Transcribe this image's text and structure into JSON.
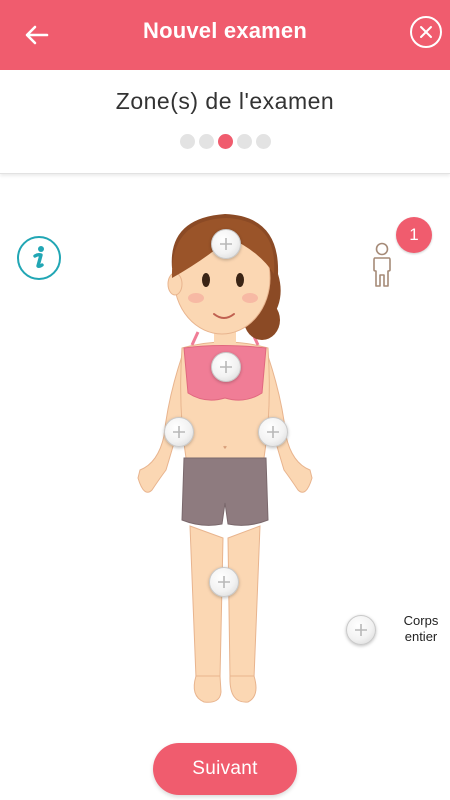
{
  "header": {
    "title": "Nouvel examen",
    "back_icon": "arrow-left-icon",
    "close_icon": "close-icon",
    "background": "#f05c6e"
  },
  "step": {
    "title": "Zone(s) de l'examen",
    "total_steps": 5,
    "current_step": 3,
    "active_color": "#f05c6e",
    "inactive_color": "#e3e3e3"
  },
  "info": {
    "icon": "info-icon",
    "color": "#21a6b4"
  },
  "body_selector": {
    "selected_count": "1",
    "person_icon": "person-outline-icon",
    "zones": [
      {
        "name": "zone-head-button",
        "id": "head"
      },
      {
        "name": "zone-chest-button",
        "id": "chest"
      },
      {
        "name": "zone-right-arm-button",
        "id": "right-arm"
      },
      {
        "name": "zone-left-arm-button",
        "id": "left-arm"
      },
      {
        "name": "zone-legs-button",
        "id": "legs"
      },
      {
        "name": "zone-whole-body-button",
        "id": "whole-body"
      }
    ],
    "whole_body_label": "Corps entier"
  },
  "footer": {
    "next_label": "Suivant"
  }
}
